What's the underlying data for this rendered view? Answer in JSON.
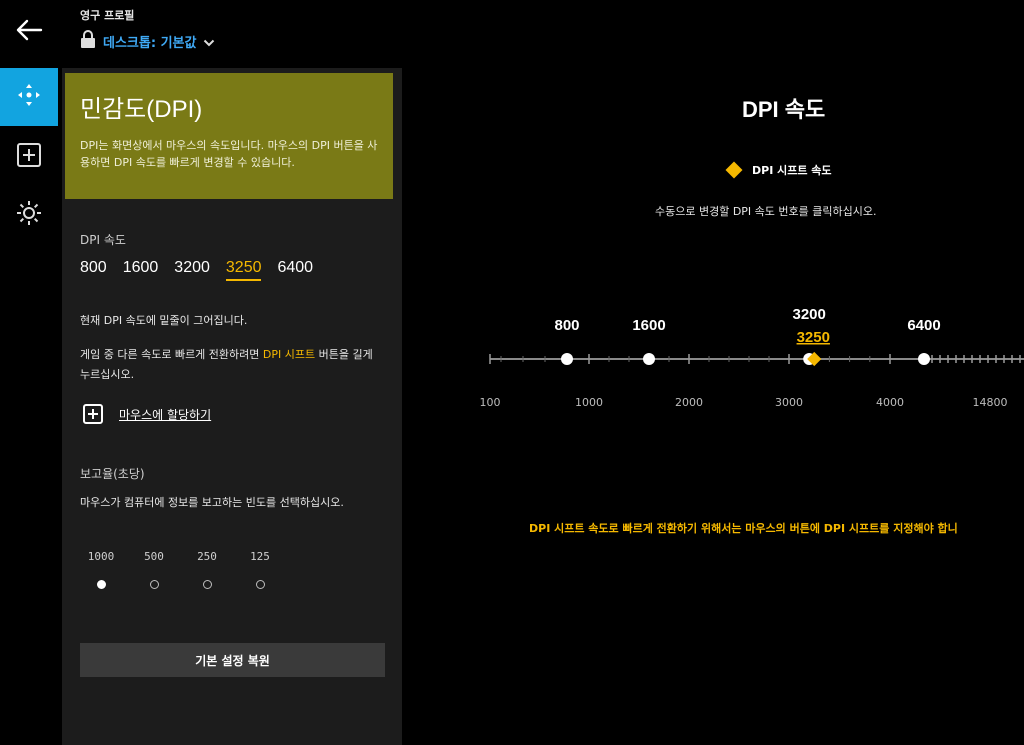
{
  "header": {
    "profile_label": "영구 프로필",
    "profile_name": "데스크톱: 기본값"
  },
  "panel": {
    "title": "민감도(DPI)",
    "description": "DPI는 화면상에서 마우스의 속도입니다. 마우스의 DPI 버튼을 사용하면 DPI 속도를 빠르게 변경할 수 있습니다.",
    "dpi_label": "DPI 속도",
    "dpi_values": [
      "800",
      "1600",
      "3200",
      "3250",
      "6400"
    ],
    "active_dpi": "3250",
    "current_note": "현재 DPI 속도에 밑줄이 그어집니다.",
    "shift_note_before": "게임 중 다른 속도로 빠르게 전환하려면 ",
    "shift_note_highlight": "DPI 시프트",
    "shift_note_after": " 버튼을 길게 누르십시오.",
    "assign_label": "마우스에 할당하기",
    "report_label": "보고율(초당)",
    "report_desc": "마우스가 컴퓨터에 정보를 보고하는 빈도를 선택하십시오.",
    "report_rates": [
      "1000",
      "500",
      "250",
      "125"
    ],
    "selected_rate": "1000",
    "reset_label": "기본 설정 복원"
  },
  "main": {
    "title": "DPI 속도",
    "legend_label": "DPI 시프트 속도",
    "instruction": "수동으로 변경할 DPI 속도 번호를 클릭하십시오.",
    "shift_warning": "DPI 시프트 속도로 빠르게 전환하기 위해서는 마우스의 버튼에 DPI 시프트를 지정해야 합니"
  },
  "slider": {
    "axis_labels": [
      "100",
      "1000",
      "2000",
      "3000",
      "4000",
      "14800"
    ],
    "points": [
      {
        "label": "800",
        "value": 800
      },
      {
        "label": "1600",
        "value": 1600
      },
      {
        "label": "3200",
        "value": 3200
      },
      {
        "label": "6400",
        "value": 6400
      }
    ],
    "shift_point": {
      "label": "3250",
      "value": 3250
    }
  },
  "colors": {
    "accent": "#f5b800",
    "rail_active": "#12a4e0",
    "header_bg": "#7a7a16",
    "profile_link": "#3fa9f5"
  }
}
